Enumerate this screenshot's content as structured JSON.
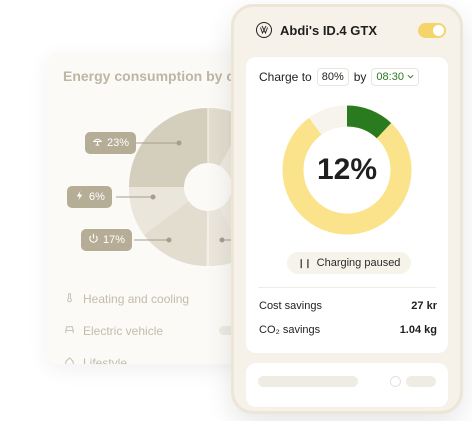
{
  "energy_card": {
    "title": "Energy consumption by c",
    "pie_segments": [
      {
        "label": "Heating and cooling",
        "percent": 23,
        "color": "#d4cebd",
        "icon": "heat-icon"
      },
      {
        "label": "Electric vehicle",
        "percent": 6,
        "color": "#ebe6db",
        "icon": "bolt-icon"
      },
      {
        "label": "Lifestyle",
        "percent": 17,
        "color": "#e3ddcf",
        "icon": "power-icon"
      }
    ],
    "pills": [
      {
        "text": "23%",
        "icon": "lamp-icon"
      },
      {
        "text": "6%",
        "icon": "bolt-icon"
      },
      {
        "text": "17%",
        "icon": "power-icon"
      }
    ],
    "legend": [
      {
        "label": "Heating and cooling",
        "icon": "thermometer-icon"
      },
      {
        "label": "Electric vehicle",
        "icon": "car-icon"
      },
      {
        "label": "Lifestyle",
        "icon": "home-icon"
      }
    ]
  },
  "phone": {
    "car_name": "Abdi's ID.4 GTX",
    "toggle_on": true,
    "charge": {
      "label_prefix": "Charge to",
      "target": "80%",
      "label_by": "by",
      "time": "08:30"
    },
    "progress": {
      "percent_text": "12%",
      "fraction": 0.12,
      "fill_color": "#2a7a1f",
      "track_color": "#fae38a"
    },
    "status": "Charging paused",
    "savings": [
      {
        "label": "Cost savings",
        "value": "27 kr"
      },
      {
        "label": "CO₂ savings",
        "value": "1.04 kg"
      }
    ]
  }
}
